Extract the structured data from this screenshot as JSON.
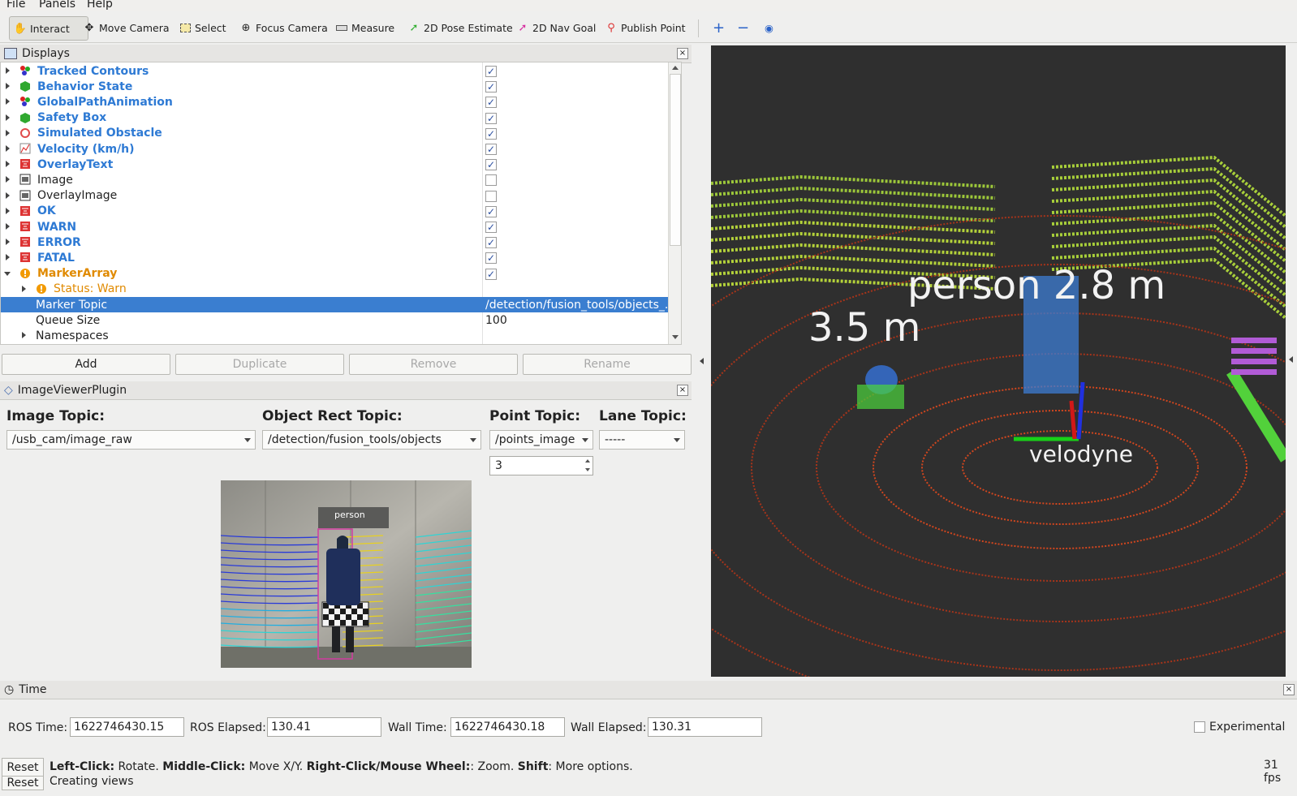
{
  "menu": [
    {
      "label": "File"
    },
    {
      "label": "Panels"
    },
    {
      "label": "Help"
    }
  ],
  "toolbar": {
    "tools": [
      {
        "label": "Interact",
        "icon": "hand-icon"
      },
      {
        "label": "Move Camera",
        "icon": "move-icon"
      },
      {
        "label": "Select",
        "icon": "select-icon"
      },
      {
        "label": "Focus Camera",
        "icon": "focus-icon"
      },
      {
        "label": "Measure",
        "icon": "ruler-icon"
      },
      {
        "label": "2D Pose Estimate",
        "icon": "green-arrow-icon"
      },
      {
        "label": "2D Nav Goal",
        "icon": "pink-arrow-icon"
      },
      {
        "label": "Publish Point",
        "icon": "pin-icon"
      }
    ]
  },
  "displays": {
    "title": "Displays",
    "items": [
      {
        "label": "Tracked Contours",
        "checked": true,
        "style": "blue"
      },
      {
        "label": "Behavior State",
        "checked": true,
        "style": "blue"
      },
      {
        "label": "GlobalPathAnimation",
        "checked": true,
        "style": "blue"
      },
      {
        "label": "Safety Box",
        "checked": true,
        "style": "blue"
      },
      {
        "label": "Simulated Obstacle",
        "checked": true,
        "style": "blue"
      },
      {
        "label": "Velocity (km/h)",
        "checked": true,
        "style": "blue"
      },
      {
        "label": "OverlayText",
        "checked": true,
        "style": "blue"
      },
      {
        "label": "Image",
        "checked": false,
        "style": "plain"
      },
      {
        "label": "OverlayImage",
        "checked": false,
        "style": "plain"
      },
      {
        "label": "OK",
        "checked": true,
        "style": "blue"
      },
      {
        "label": "WARN",
        "checked": true,
        "style": "blue"
      },
      {
        "label": "ERROR",
        "checked": true,
        "style": "blue"
      },
      {
        "label": "FATAL",
        "checked": true,
        "style": "blue"
      },
      {
        "label": "MarkerArray",
        "checked": true,
        "style": "orange"
      }
    ],
    "status": "Status: Warn",
    "marker_topic_label": "Marker Topic",
    "marker_topic_value": "/detection/fusion_tools/objects_...",
    "queue_label": "Queue Size",
    "queue_value": "100",
    "namespaces_label": "Namespaces",
    "buttons": {
      "add": "Add",
      "duplicate": "Duplicate",
      "remove": "Remove",
      "rename": "Rename"
    }
  },
  "image_viewer": {
    "title": "ImageViewerPlugin",
    "image_topic_label": "Image Topic:",
    "image_topic_value": "/usb_cam/image_raw",
    "object_rect_label": "Object Rect Topic:",
    "object_rect_value": "/detection/fusion_tools/objects",
    "point_topic_label": "Point Topic:",
    "point_topic_value": "/points_image",
    "point_size": "3",
    "lane_topic_label": "Lane Topic:",
    "lane_topic_value": "-----",
    "detection_label": "person"
  },
  "viewport": {
    "label_person": "person  2.8  m",
    "label_distance": "3.5  m",
    "label_frame": "velodyne"
  },
  "time": {
    "title": "Time",
    "ros_time_label": "ROS Time:",
    "ros_time": "1622746430.15",
    "ros_elapsed_label": "ROS Elapsed:",
    "ros_elapsed": "130.41",
    "wall_time_label": "Wall Time:",
    "wall_time": "1622746430.18",
    "wall_elapsed_label": "Wall Elapsed:",
    "wall_elapsed": "130.31",
    "experimental_label": "Experimental"
  },
  "statusbar": {
    "reset": "Reset",
    "hint_left_b": "Left-Click:",
    "hint_left": " Rotate. ",
    "hint_mid_b": "Middle-Click:",
    "hint_mid": " Move X/Y. ",
    "hint_right_b": "Right-Click/Mouse Wheel:",
    "hint_right": ": Zoom. ",
    "hint_shift_b": "Shift",
    "hint_shift": ": More options.",
    "fps": "31 fps",
    "reset2": "Reset",
    "creating": "Creating views"
  }
}
